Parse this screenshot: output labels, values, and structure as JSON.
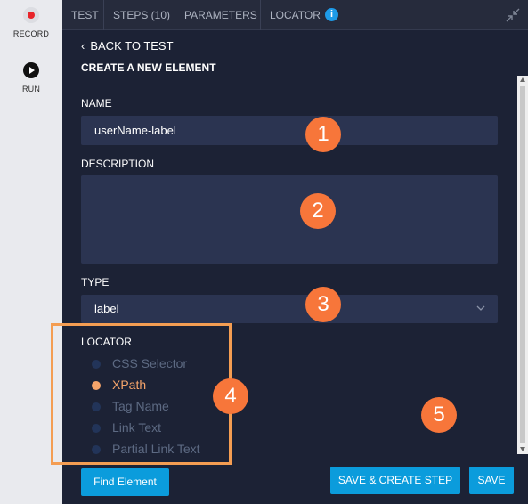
{
  "toolbar": {
    "record_label": "RECORD",
    "run_label": "RUN"
  },
  "tabs": [
    {
      "label": "TEST"
    },
    {
      "label": "STEPS (10)"
    },
    {
      "label": "PARAMETERS"
    },
    {
      "label": "LOCATOR"
    }
  ],
  "back_link": "BACK TO TEST",
  "page_title": "CREATE A NEW ELEMENT",
  "form": {
    "name_label": "NAME",
    "name_value": "userName-label",
    "description_label": "DESCRIPTION",
    "description_value": "",
    "type_label": "TYPE",
    "type_value": "label",
    "locator_label": "LOCATOR",
    "locator_options": [
      {
        "label": "CSS Selector",
        "selected": false
      },
      {
        "label": "XPath",
        "selected": true
      },
      {
        "label": "Tag Name",
        "selected": false
      },
      {
        "label": "Link Text",
        "selected": false
      },
      {
        "label": "Partial Link Text",
        "selected": false
      }
    ]
  },
  "buttons": {
    "find": "Find Element",
    "save_create": "SAVE & CREATE STEP",
    "save": "SAVE"
  },
  "annotations": [
    "1",
    "2",
    "3",
    "4",
    "5"
  ],
  "colors": {
    "background": "#1c2235",
    "field": "#2b3451",
    "accent": "#0b9cdc",
    "annotation": "#f7763a",
    "selected_option": "#f5a46a"
  },
  "icons": [
    "record-icon",
    "run-icon",
    "info-icon",
    "collapse-icon",
    "chevron-left-icon",
    "chevron-down-icon"
  ]
}
